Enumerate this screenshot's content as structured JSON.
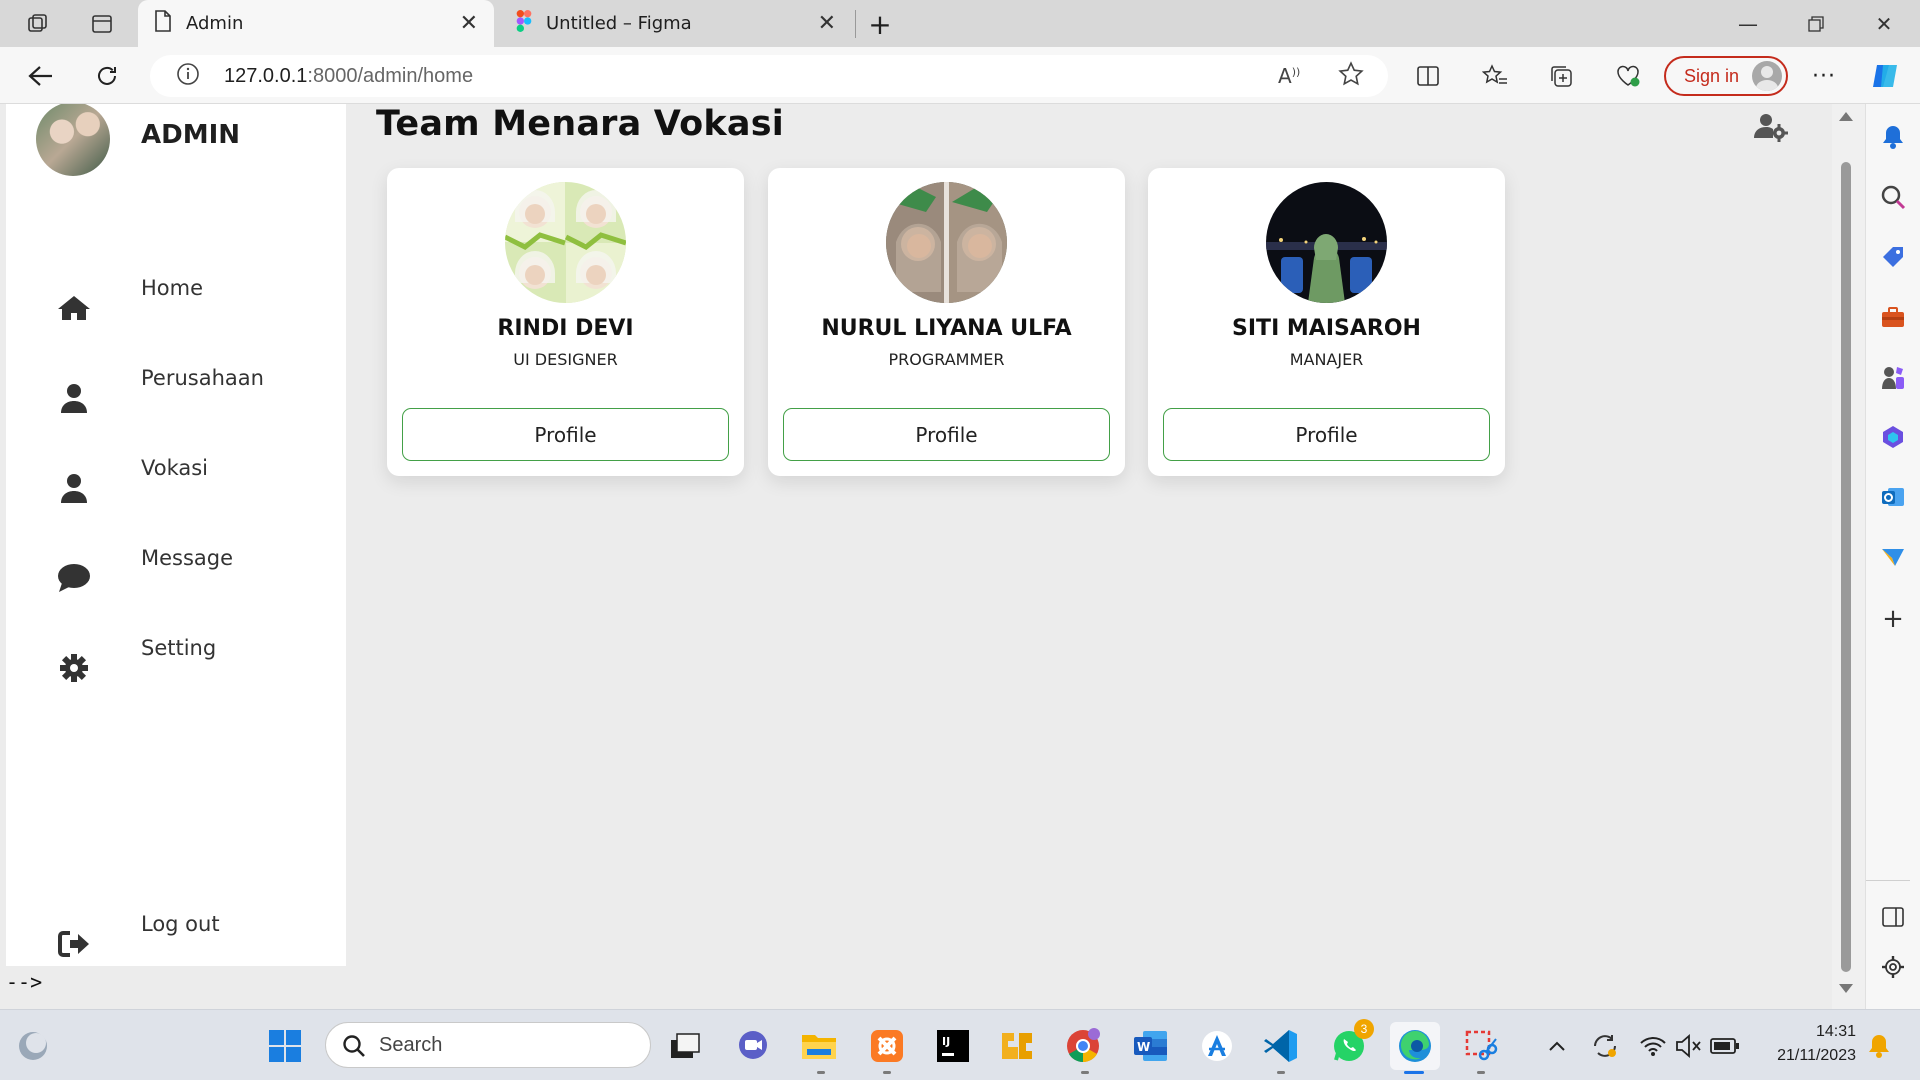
{
  "browser": {
    "tabs": [
      {
        "title": "Admin",
        "active": true
      },
      {
        "title": "Untitled – Figma",
        "active": false
      }
    ],
    "url_host": "127.0.0.1",
    "url_rest": ":8000/admin/home",
    "sign_in_label": "Sign in"
  },
  "sidebar": {
    "title": "ADMIN",
    "items": [
      {
        "label": "Home",
        "icon": "home-icon"
      },
      {
        "label": "Perusahaan",
        "icon": "user-icon"
      },
      {
        "label": "Vokasi",
        "icon": "user-icon"
      },
      {
        "label": "Message",
        "icon": "chat-icon"
      },
      {
        "label": "Setting",
        "icon": "gear-icon"
      }
    ],
    "logout_label": "Log out"
  },
  "main": {
    "title": "Team Menara Vokasi",
    "cards": [
      {
        "name": "RINDI DEVI",
        "role": "UI DESIGNER",
        "button": "Profile"
      },
      {
        "name": "NURUL LIYANA ULFA",
        "role": "PROGRAMMER",
        "button": "Profile"
      },
      {
        "name": "SITI MAISAROH",
        "role": "MANAJER",
        "button": "Profile"
      }
    ],
    "stray_text": "-->"
  },
  "taskbar": {
    "search_placeholder": "Search",
    "whatsapp_badge": "3",
    "time": "14:31",
    "date": "21/11/2023"
  },
  "colors": {
    "accent_green": "#43a047",
    "signin_red": "#c42b1c",
    "page_bg": "#ececec"
  }
}
